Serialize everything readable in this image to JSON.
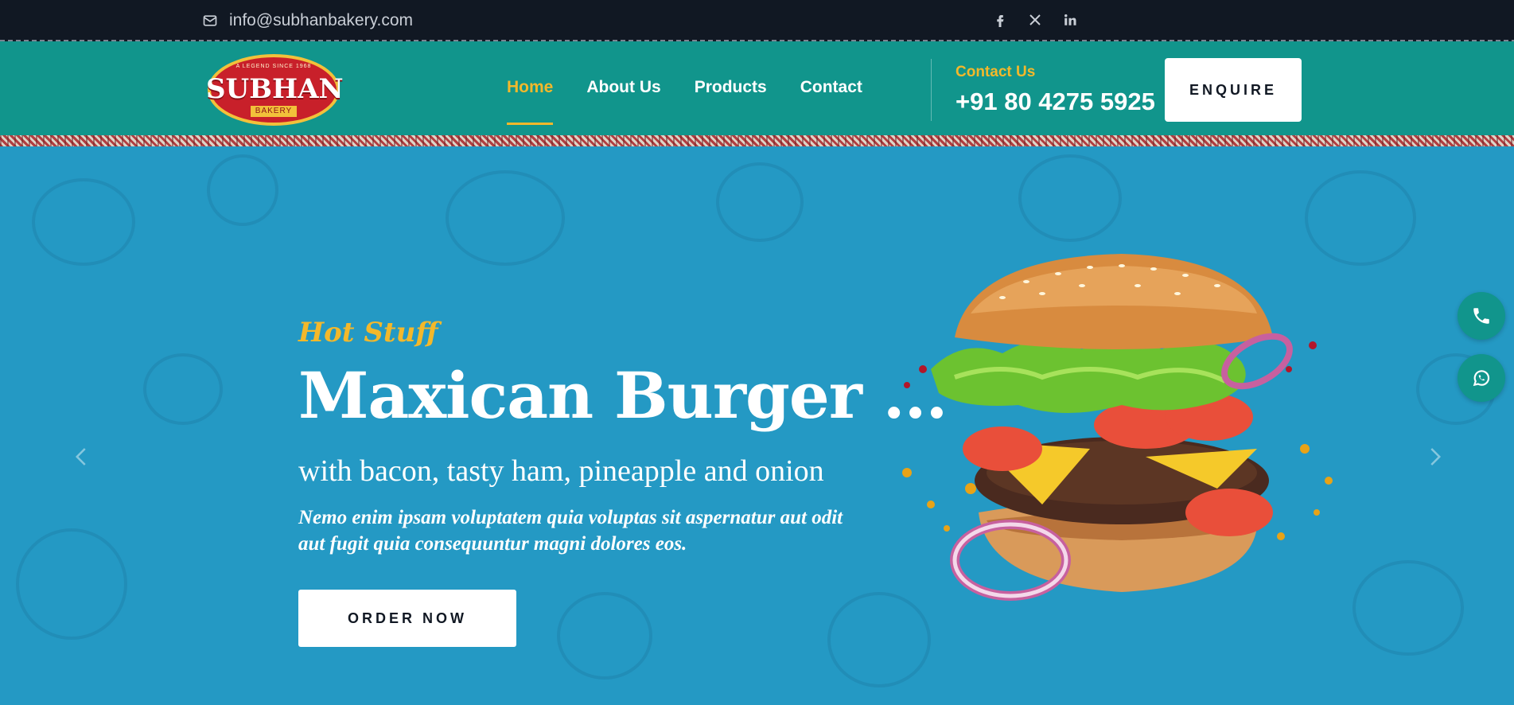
{
  "topbar": {
    "email": "info@subhanbakery.com",
    "icons": [
      "envelope-icon",
      "facebook-icon",
      "x-icon",
      "linkedin-icon"
    ]
  },
  "logo": {
    "tagline": "A LEGEND SINCE 1968",
    "name": "SUBHAN",
    "sub": "BAKERY"
  },
  "nav": {
    "items": [
      {
        "label": "Home",
        "active": true
      },
      {
        "label": "About Us",
        "active": false
      },
      {
        "label": "Products",
        "active": false
      },
      {
        "label": "Contact",
        "active": false
      }
    ]
  },
  "contact": {
    "label": "Contact Us",
    "phone": "+91 80 4275 5925"
  },
  "enquire_label": "ENQUIRE",
  "hero": {
    "kicker": "Hot Stuff",
    "title": "Maxican Burger ...",
    "subtitle": "with bacon, tasty ham, pineapple and onion",
    "description": "Nemo enim ipsam voluptatem quia voluptas sit aspernatur aut odit aut fugit quia consequuntur magni dolores eos.",
    "button": "ORDER NOW",
    "image": "burger-image"
  },
  "floating": [
    "phone-icon",
    "whatsapp-icon"
  ],
  "colors": {
    "topbar": "#111823",
    "header": "#11958c",
    "hero": "#2499c4",
    "accent": "#f3b82b"
  }
}
